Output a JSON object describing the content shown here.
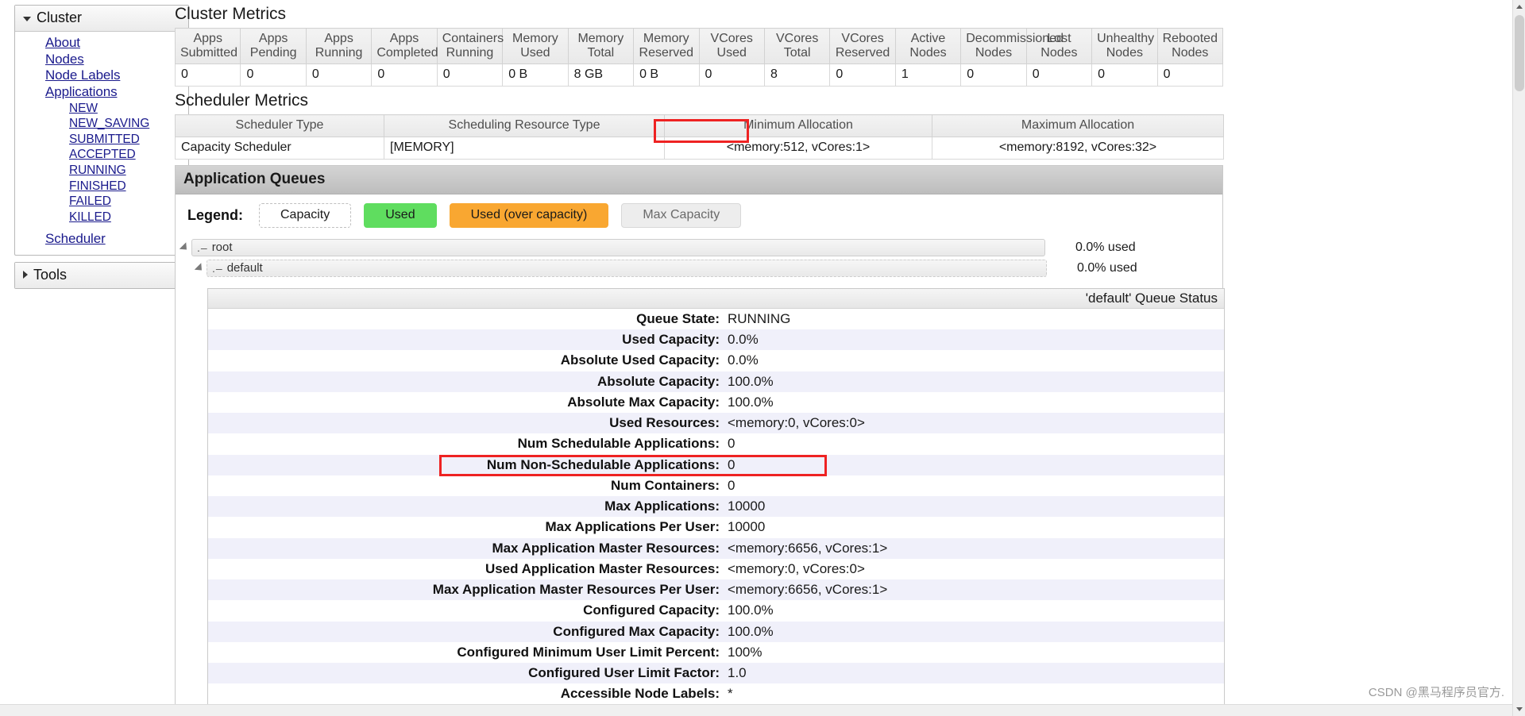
{
  "sidebar": {
    "cluster": {
      "title": "Cluster",
      "expanded": true,
      "links": [
        {
          "label": "About"
        },
        {
          "label": "Nodes"
        },
        {
          "label": "Node Labels"
        },
        {
          "label": "Applications"
        }
      ],
      "app_states": [
        {
          "label": "NEW"
        },
        {
          "label": "NEW_SAVING"
        },
        {
          "label": "SUBMITTED"
        },
        {
          "label": "ACCEPTED"
        },
        {
          "label": "RUNNING"
        },
        {
          "label": "FINISHED"
        },
        {
          "label": "FAILED"
        },
        {
          "label": "KILLED"
        }
      ],
      "scheduler_link": {
        "label": "Scheduler"
      }
    },
    "tools": {
      "title": "Tools",
      "expanded": false
    }
  },
  "cluster_metrics": {
    "title": "Cluster Metrics",
    "columns": [
      {
        "line1": "Apps",
        "line2": "Submitted"
      },
      {
        "line1": "Apps",
        "line2": "Pending"
      },
      {
        "line1": "Apps",
        "line2": "Running"
      },
      {
        "line1": "Apps",
        "line2": "Completed"
      },
      {
        "line1": "Containers",
        "line2": "Running"
      },
      {
        "line1": "Memory",
        "line2": "Used"
      },
      {
        "line1": "Memory",
        "line2": "Total"
      },
      {
        "line1": "Memory",
        "line2": "Reserved"
      },
      {
        "line1": "VCores",
        "line2": "Used"
      },
      {
        "line1": "VCores",
        "line2": "Total"
      },
      {
        "line1": "VCores",
        "line2": "Reserved"
      },
      {
        "line1": "Active",
        "line2": "Nodes"
      },
      {
        "line1": "Decommissioned",
        "line2": "Nodes"
      },
      {
        "line1": "Lost",
        "line2": "Nodes"
      },
      {
        "line1": "Unhealthy",
        "line2": "Nodes"
      },
      {
        "line1": "Rebooted",
        "line2": "Nodes"
      }
    ],
    "values": [
      "0",
      "0",
      "0",
      "0",
      "0",
      "0 B",
      "8 GB",
      "0 B",
      "0",
      "8",
      "0",
      "1",
      "0",
      "0",
      "0",
      "0"
    ]
  },
  "scheduler_metrics": {
    "title": "Scheduler Metrics",
    "columns": [
      "Scheduler Type",
      "Scheduling Resource Type",
      "Minimum Allocation",
      "Maximum Allocation"
    ],
    "row": {
      "scheduler_type": "Capacity Scheduler",
      "resource_type": "[MEMORY]",
      "minimum_allocation": "<memory:512, vCores:1>",
      "maximum_allocation": "<memory:8192, vCores:32>"
    }
  },
  "application_queues": {
    "title": "Application Queues",
    "legend": {
      "label": "Legend:",
      "items": [
        {
          "label": "Capacity",
          "style": "capacity"
        },
        {
          "label": "Used",
          "style": "used"
        },
        {
          "label": "Used (over capacity)",
          "style": "over"
        },
        {
          "label": "Max Capacity",
          "style": "max"
        }
      ]
    },
    "queues": [
      {
        "name": "root",
        "used": "0.0% used",
        "level": 1
      },
      {
        "name": "default",
        "used": "0.0% used",
        "level": 2
      }
    ]
  },
  "queue_status": {
    "header_title": "'default' Queue Status",
    "rows": [
      {
        "key": "Queue State:",
        "value": "RUNNING"
      },
      {
        "key": "Used Capacity:",
        "value": "0.0%"
      },
      {
        "key": "Absolute Used Capacity:",
        "value": "0.0%"
      },
      {
        "key": "Absolute Capacity:",
        "value": "100.0%"
      },
      {
        "key": "Absolute Max Capacity:",
        "value": "100.0%"
      },
      {
        "key": "Used Resources:",
        "value": "<memory:0, vCores:0>"
      },
      {
        "key": "Num Schedulable Applications:",
        "value": "0"
      },
      {
        "key": "Num Non-Schedulable Applications:",
        "value": "0"
      },
      {
        "key": "Num Containers:",
        "value": "0"
      },
      {
        "key": "Max Applications:",
        "value": "10000"
      },
      {
        "key": "Max Applications Per User:",
        "value": "10000"
      },
      {
        "key": "Max Application Master Resources:",
        "value": "<memory:6656, vCores:1>"
      },
      {
        "key": "Used Application Master Resources:",
        "value": "<memory:0, vCores:0>"
      },
      {
        "key": "Max Application Master Resources Per User:",
        "value": "<memory:6656, vCores:1>"
      },
      {
        "key": "Configured Capacity:",
        "value": "100.0%"
      },
      {
        "key": "Configured Max Capacity:",
        "value": "100.0%"
      },
      {
        "key": "Configured Minimum User Limit Percent:",
        "value": "100%"
      },
      {
        "key": "Configured User Limit Factor:",
        "value": "1.0"
      },
      {
        "key": "Accessible Node Labels:",
        "value": "*"
      }
    ]
  },
  "annotations": {
    "color": "#ee2222",
    "boxes": [
      {
        "name": "minimum-allocation-highlight"
      },
      {
        "name": "max-am-resources-highlight"
      }
    ]
  },
  "watermark": {
    "text": "CSDN @黑马程序员官方."
  }
}
